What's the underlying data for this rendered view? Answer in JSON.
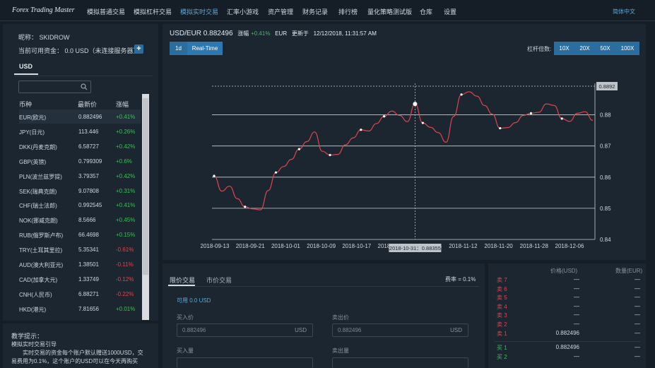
{
  "nav": {
    "logo": "Forex Trading Master",
    "items": [
      "模拟普通交易",
      "模拟杠杆交易",
      "模拟实时交易",
      "汇率小游戏",
      "资产管理",
      "财务记录",
      "排行榜",
      "量化策略测试版",
      "仓库",
      "设置"
    ],
    "lang": "简体中文"
  },
  "account": {
    "nickname": "昵称： SKIDROW",
    "funds": "当前可用资金： 0.0 USD（未连接服务器）",
    "add": "+",
    "currency_tab": "USD"
  },
  "table": {
    "headers": [
      "币种",
      "最新价",
      "涨幅"
    ],
    "rows": [
      [
        "EUR(欧元)",
        "0.882496",
        "+0.41%"
      ],
      [
        "JPY(日元)",
        "113.446",
        "+0.26%"
      ],
      [
        "DKK(丹麦克朗)",
        "6.58727",
        "+0.42%"
      ],
      [
        "GBP(英镑)",
        "0.799309",
        "+0.6%"
      ],
      [
        "PLN(波兰兹罗提)",
        "3.79357",
        "+0.42%"
      ],
      [
        "SEK(瑞典克朗)",
        "9.07808",
        "+0.31%"
      ],
      [
        "CHF(瑞士法郎)",
        "0.992545",
        "+0.41%"
      ],
      [
        "NOK(挪威克朗)",
        "8.5666",
        "+0.45%"
      ],
      [
        "RUB(俄罗斯卢布)",
        "66.4698",
        "+0.15%"
      ],
      [
        "TRY(土耳其里拉)",
        "5.35341",
        "-0.61%"
      ],
      [
        "AUD(澳大利亚元)",
        "1.38501",
        "-0.11%"
      ],
      [
        "CAD(加拿大元)",
        "1.33749",
        "-0.12%"
      ],
      [
        "CNH(人民币)",
        "6.88271",
        "-0.22%"
      ],
      [
        "HKD(港元)",
        "7.81656",
        "+0.01%"
      ]
    ]
  },
  "tips": {
    "title": "教学提示：",
    "line1": "模拟实时交易引导",
    "line2": "实时交易的资金每个账户默认赠送1000USD，交",
    "line3": "易费用为0.1%，这个账户的USD可以在今天再购买"
  },
  "chart": {
    "pair": "USD/EUR",
    "price": "0.882496",
    "change_label": "涨幅",
    "change": "+0.41%",
    "unit": "EUR",
    "updated_label": "更新于",
    "updated": "12/12/2018, 11:31:57 AM",
    "range_buttons": [
      "1d",
      "Real-Time"
    ],
    "leverage_label": "杠杆倍数:",
    "leverage": [
      "10X",
      "20X",
      "50X",
      "100X"
    ],
    "price_flag": "0.8892",
    "crosshair_label": "2018-10-31：0.88355"
  },
  "chart_data": {
    "type": "line",
    "x": [
      "2018-09-13",
      "2018-09-21",
      "2018-10-01",
      "2018-10-09",
      "2018-10-17",
      "2018-10-25",
      "2018-11-04",
      "2018-11-12",
      "2018-11-20",
      "2018-11-28",
      "2018-12-06"
    ],
    "xticks": [
      "2018-09-13",
      "2018-09-21",
      "2018-10-01",
      "2018-10-09",
      "2018-10-17",
      "2018-10-25",
      "2018-11-04",
      "2018-11-12",
      "2018-11-20",
      "2018-11-28",
      "2018-12-06"
    ],
    "yticks": [
      "0.84",
      "0.85",
      "0.86",
      "0.87",
      "0.88"
    ],
    "ylim": [
      0.84,
      0.8892
    ],
    "series": [
      {
        "name": "USD/EUR",
        "values": [
          0.8604,
          0.8555,
          0.8571,
          0.8531,
          0.8505,
          0.8498,
          0.8495,
          0.8557,
          0.8615,
          0.8634,
          0.8657,
          0.869,
          0.8714,
          0.8745,
          0.8683,
          0.8671,
          0.8673,
          0.8704,
          0.8726,
          0.8752,
          0.8748,
          0.8772,
          0.8795,
          0.8812,
          0.8798,
          0.8778,
          0.8835,
          0.8774,
          0.876,
          0.8743,
          0.8712,
          0.8795,
          0.8865,
          0.8874,
          0.886,
          0.883,
          0.8802,
          0.8757,
          0.8759,
          0.8775,
          0.8798,
          0.8805,
          0.8808,
          0.8835,
          0.883,
          0.8788,
          0.8779,
          0.8805,
          0.881,
          0.8782
        ]
      }
    ]
  },
  "trade": {
    "tabs": [
      "限价交易",
      "市价交易"
    ],
    "fee": "费率 = 0.1%",
    "available": "可用 0.0 USD",
    "buy_price_label": "买入价",
    "sell_price_label": "卖出价",
    "buy_price": "0.882496",
    "sell_price": "0.882496",
    "unit": "USD",
    "buy_qty_label": "买入量",
    "sell_qty_label": "卖出量"
  },
  "book": {
    "price_header": "价格(USD)",
    "qty_header": "数量(EUR)",
    "asks": [
      [
        "卖 7",
        "—",
        "—"
      ],
      [
        "卖 6",
        "—",
        "—"
      ],
      [
        "卖 5",
        "—",
        "—"
      ],
      [
        "卖 4",
        "—",
        "—"
      ],
      [
        "卖 3",
        "—",
        "—"
      ],
      [
        "卖 2",
        "—",
        "—"
      ],
      [
        "卖 1",
        "0.882496",
        "—"
      ]
    ],
    "bids": [
      [
        "买 1",
        "0.882496",
        "—"
      ],
      [
        "买 2",
        "—",
        "—"
      ]
    ]
  }
}
